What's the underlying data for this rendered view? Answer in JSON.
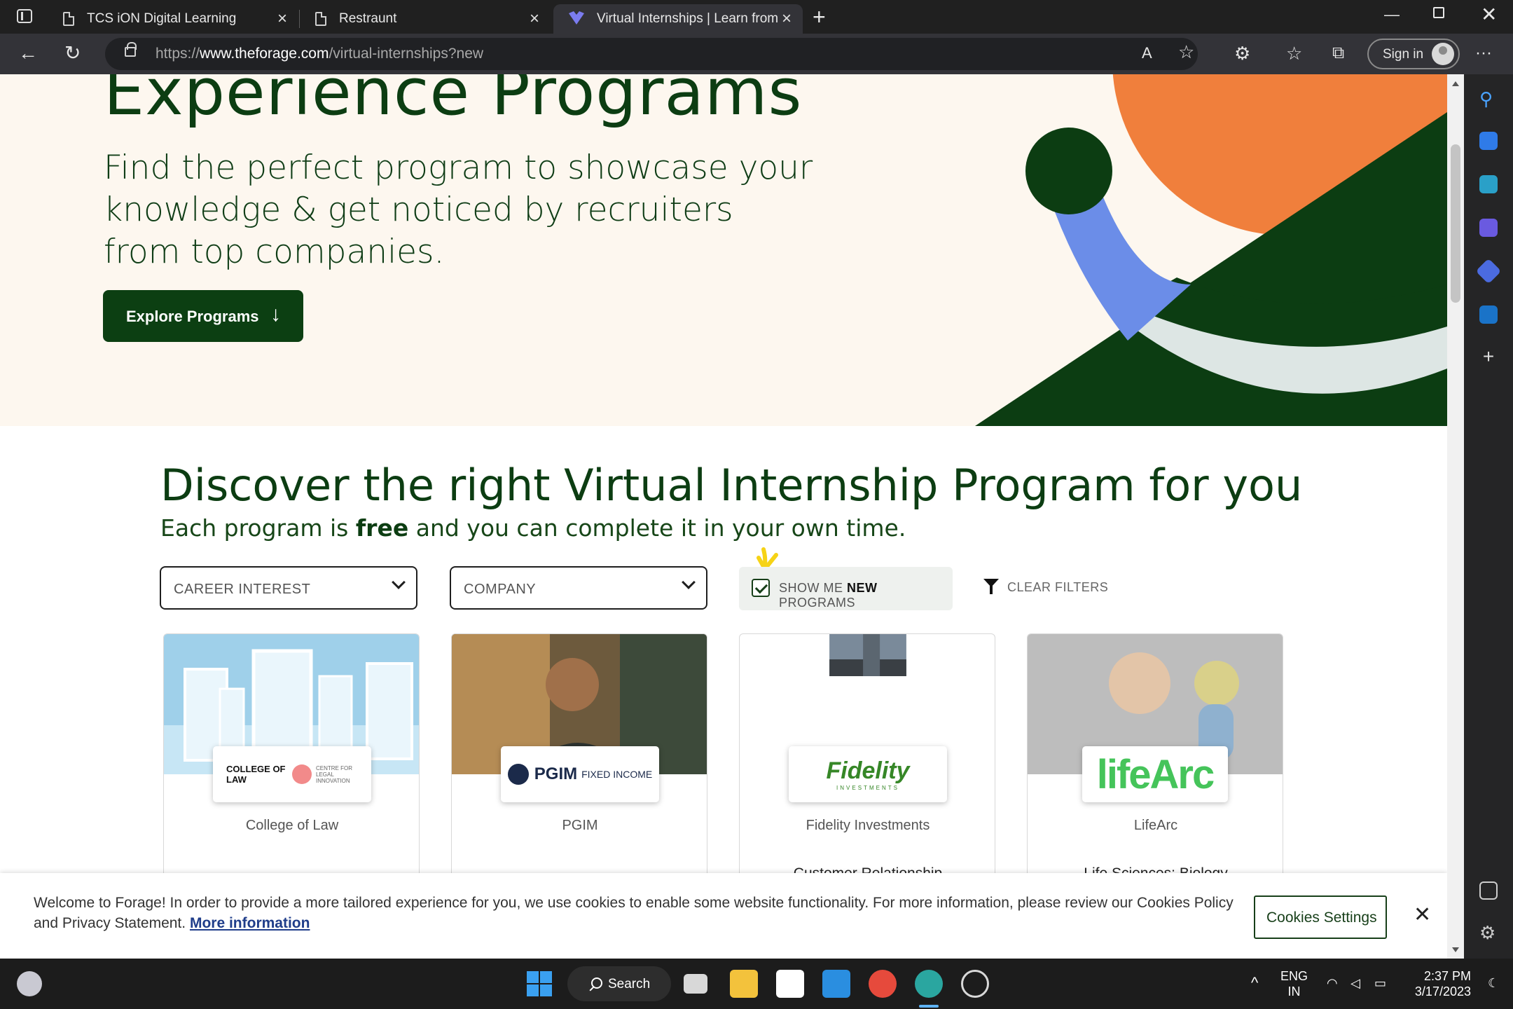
{
  "browser": {
    "tabs": [
      {
        "title": "TCS iON Digital Learning"
      },
      {
        "title": "Restraunt"
      },
      {
        "title": "Virtual Internships | Learn from re"
      }
    ],
    "url_prefix": "https://",
    "url_domain": "www.theforage.com",
    "url_path": "/virtual-internships?new",
    "sign_in": "Sign in"
  },
  "hero": {
    "title": "Experience Programs",
    "subtitle": "Find the perfect program to showcase your knowledge & get noticed by recruiters from top companies.",
    "cta": "Explore Programs"
  },
  "discover": {
    "title": "Discover the right Virtual Internship Program for you",
    "sub_before": "Each program is ",
    "sub_bold": "free",
    "sub_after": " and you can complete it in your own time."
  },
  "filters": {
    "career_interest": "CAREER INTEREST",
    "company": "COMPANY",
    "new_toggle_before": "SHOW ME ",
    "new_toggle_bold": "NEW",
    "new_toggle_after": " PROGRAMS",
    "new_checked": true,
    "clear": "CLEAR FILTERS"
  },
  "cards": [
    {
      "company": "College of Law",
      "logo_text_a": "COLLEGE OF LAW",
      "logo_text_b": "CENTRE FOR LEGAL INNOVATION",
      "program": ""
    },
    {
      "company": "PGIM",
      "logo_text_a": "PGIM",
      "logo_text_b": "FIXED INCOME",
      "program": ""
    },
    {
      "company": "Fidelity Investments",
      "logo_text_a": "Fidelity",
      "logo_text_b": "INVESTMENTS",
      "program": "Customer Relationship"
    },
    {
      "company": "LifeArc",
      "logo_text_a": "lifeArc",
      "logo_text_b": "",
      "program": "Life Sciences: Biology"
    }
  ],
  "cookie": {
    "text": "Welcome to Forage! In order to provide a more tailored experience for you, we use cookies to enable some website functionality. For more information, please review our Cookies Policy and Privacy Statement.",
    "more": "More information",
    "settings": "Cookies Settings"
  },
  "taskbar": {
    "search": "Search",
    "lang_1": "ENG",
    "lang_2": "IN",
    "time": "2:37 PM",
    "date": "3/17/2023"
  },
  "colors": {
    "forest": "#0c3d12",
    "orange": "#f07f3c",
    "blue": "#6b8de8",
    "pale": "#dde6e4"
  }
}
